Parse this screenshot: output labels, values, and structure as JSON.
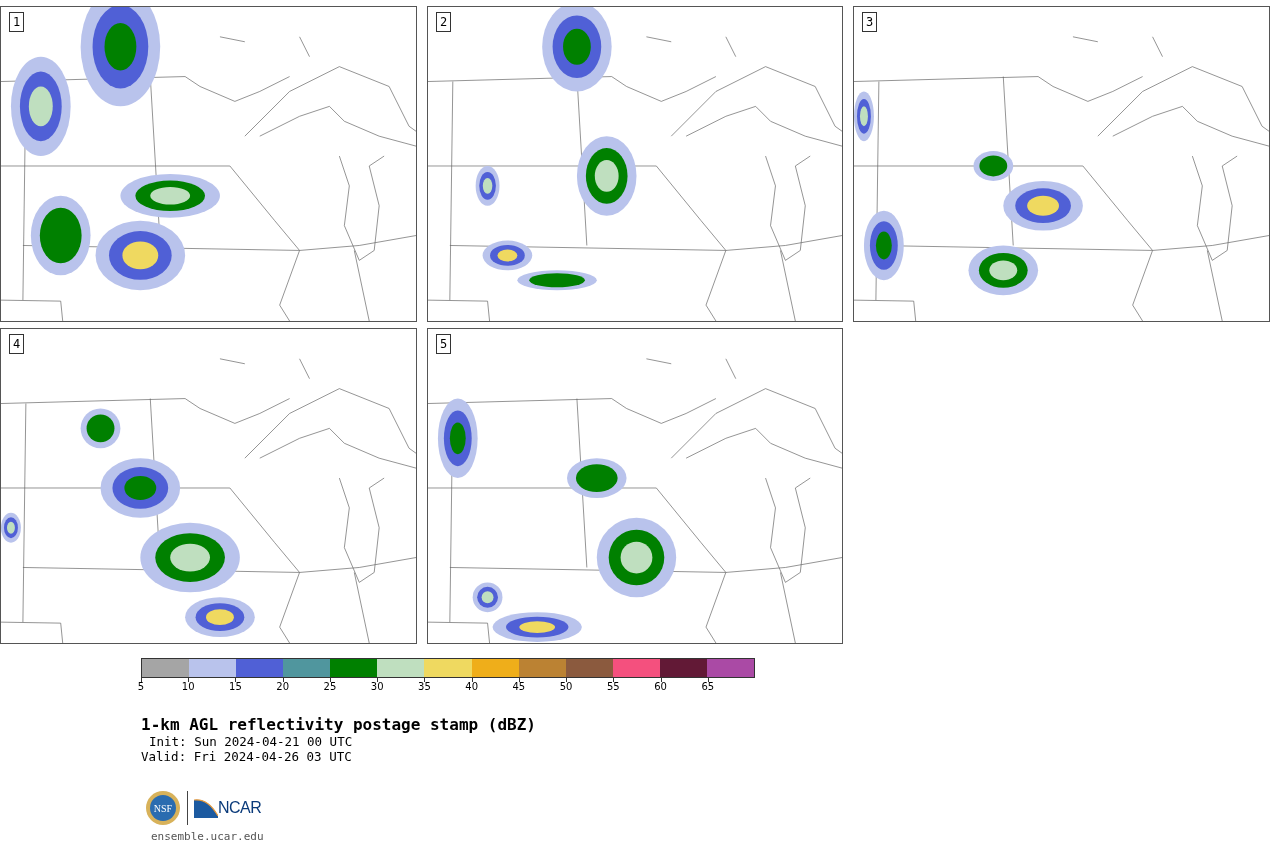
{
  "panels": [
    {
      "label": "1"
    },
    {
      "label": "2"
    },
    {
      "label": "3"
    },
    {
      "label": "4"
    },
    {
      "label": "5"
    }
  ],
  "colorbar": {
    "bins": [
      {
        "color": "#a5a5a5"
      },
      {
        "color": "#b9c3ec"
      },
      {
        "color": "#5060d6"
      },
      {
        "color": "#50969e"
      },
      {
        "color": "#008000"
      },
      {
        "color": "#bfdfbf"
      },
      {
        "color": "#efd960"
      },
      {
        "color": "#efae1a"
      },
      {
        "color": "#bb8233"
      },
      {
        "color": "#8b5a3e"
      },
      {
        "color": "#f4507e"
      },
      {
        "color": "#621936"
      },
      {
        "color": "#aa4aa5"
      }
    ],
    "ticks": [
      "5",
      "10",
      "15",
      "20",
      "25",
      "30",
      "35",
      "40",
      "45",
      "50",
      "55",
      "60",
      "65"
    ]
  },
  "title": "1-km AGL reflectivity postage stamp (dBZ)",
  "init": "Init: Sun 2024-04-21 00 UTC",
  "valid": "Valid: Fri 2024-04-26 03 UTC",
  "logos": {
    "nsf": "NSF",
    "ncar": "NCAR"
  },
  "website": "ensemble.ucar.edu"
}
